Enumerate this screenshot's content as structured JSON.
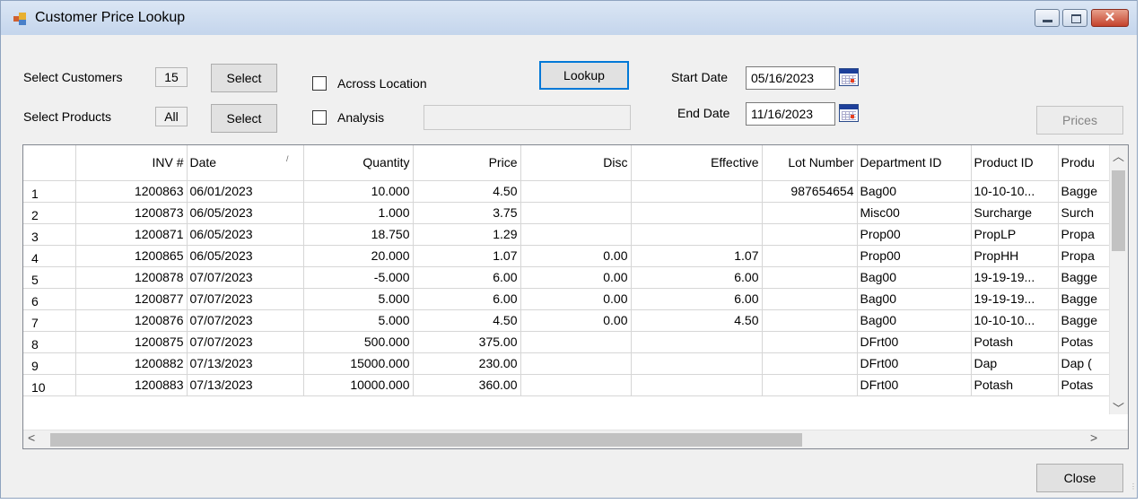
{
  "window": {
    "title": "Customer Price Lookup",
    "close_glyph": "✕"
  },
  "filters": {
    "select_customers_label": "Select Customers",
    "customers_count": "15",
    "select_products_label": "Select Products",
    "products_value": "All",
    "select_button": "Select",
    "across_location_label": "Across Location",
    "analysis_label": "Analysis",
    "lookup_button": "Lookup",
    "start_date_label": "Start Date",
    "start_date": "05/16/2023",
    "end_date_label": "End Date",
    "end_date": "11/16/2023",
    "prices_button": "Prices"
  },
  "grid": {
    "columns": [
      "INV #",
      "Date",
      "Quantity",
      "Price",
      "Disc",
      "Effective",
      "Lot Number",
      "Department ID",
      "Product ID",
      "Produ"
    ],
    "rows": [
      {
        "n": "1",
        "inv": "1200863",
        "date": "06/01/2023",
        "qty": "10.000",
        "price": "4.50",
        "disc": "",
        "eff": "",
        "lot": "987654654",
        "dept": "Bag00",
        "prod": "10-10-10...",
        "pdesc": "Bagge"
      },
      {
        "n": "2",
        "inv": "1200873",
        "date": "06/05/2023",
        "qty": "1.000",
        "price": "3.75",
        "disc": "",
        "eff": "",
        "lot": "",
        "dept": "Misc00",
        "prod": "Surcharge",
        "pdesc": "Surch"
      },
      {
        "n": "3",
        "inv": "1200871",
        "date": "06/05/2023",
        "qty": "18.750",
        "price": "1.29",
        "disc": "",
        "eff": "",
        "lot": "",
        "dept": "Prop00",
        "prod": "PropLP",
        "pdesc": "Propa"
      },
      {
        "n": "4",
        "inv": "1200865",
        "date": "06/05/2023",
        "qty": "20.000",
        "price": "1.07",
        "disc": "0.00",
        "eff": "1.07",
        "lot": "",
        "dept": "Prop00",
        "prod": "PropHH",
        "pdesc": "Propa"
      },
      {
        "n": "5",
        "inv": "1200878",
        "date": "07/07/2023",
        "qty": "-5.000",
        "price": "6.00",
        "disc": "0.00",
        "eff": "6.00",
        "lot": "",
        "dept": "Bag00",
        "prod": "19-19-19...",
        "pdesc": "Bagge"
      },
      {
        "n": "6",
        "inv": "1200877",
        "date": "07/07/2023",
        "qty": "5.000",
        "price": "6.00",
        "disc": "0.00",
        "eff": "6.00",
        "lot": "",
        "dept": "Bag00",
        "prod": "19-19-19...",
        "pdesc": "Bagge"
      },
      {
        "n": "7",
        "inv": "1200876",
        "date": "07/07/2023",
        "qty": "5.000",
        "price": "4.50",
        "disc": "0.00",
        "eff": "4.50",
        "lot": "",
        "dept": "Bag00",
        "prod": "10-10-10...",
        "pdesc": "Bagge"
      },
      {
        "n": "8",
        "inv": "1200875",
        "date": "07/07/2023",
        "qty": "500.000",
        "price": "375.00",
        "disc": "",
        "eff": "",
        "lot": "",
        "dept": "DFrt00",
        "prod": "Potash",
        "pdesc": "Potas"
      },
      {
        "n": "9",
        "inv": "1200882",
        "date": "07/13/2023",
        "qty": "15000.000",
        "price": "230.00",
        "disc": "",
        "eff": "",
        "lot": "",
        "dept": "DFrt00",
        "prod": "Dap",
        "pdesc": "Dap ("
      },
      {
        "n": "10",
        "inv": "1200883",
        "date": "07/13/2023",
        "qty": "10000.000",
        "price": "360.00",
        "disc": "",
        "eff": "",
        "lot": "",
        "dept": "DFrt00",
        "prod": "Potash",
        "pdesc": "Potas"
      }
    ]
  },
  "footer": {
    "close_button": "Close"
  }
}
